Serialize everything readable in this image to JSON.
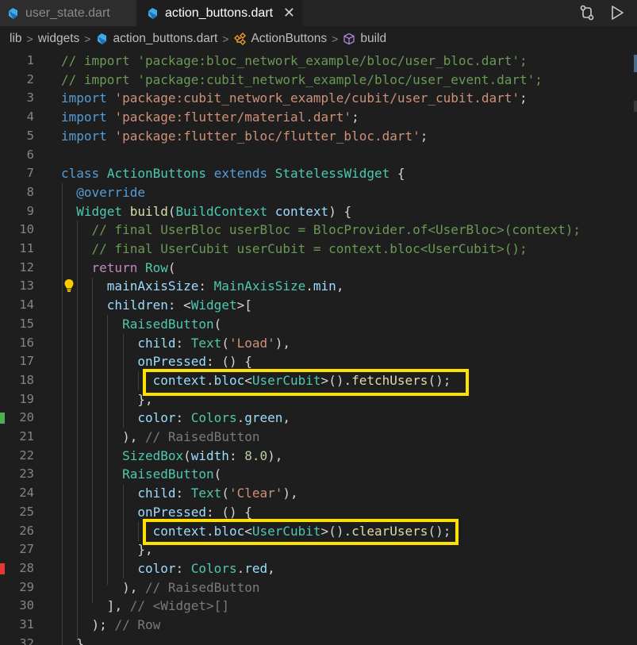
{
  "tabs": [
    {
      "label": "user_state.dart",
      "active": false,
      "icon": "dart-icon"
    },
    {
      "label": "action_buttons.dart",
      "active": true,
      "icon": "dart-icon",
      "close": "✕"
    }
  ],
  "toolbar_icons": [
    "source-control-compare-icon",
    "run-play-icon"
  ],
  "breadcrumbs": {
    "items": [
      "lib",
      "widgets",
      "action_buttons.dart",
      "ActionButtons",
      "build"
    ],
    "separator": ">"
  },
  "lines": [
    {
      "n": "1",
      "text": "// import 'package:bloc_network_example/bloc/user_bloc.dart';"
    },
    {
      "n": "2",
      "text": "// import 'package:cubit_network_example/bloc/user_event.dart';"
    },
    {
      "n": "3",
      "text": "import 'package:cubit_network_example/cubit/user_cubit.dart';"
    },
    {
      "n": "4",
      "text": "import 'package:flutter/material.dart';"
    },
    {
      "n": "5",
      "text": "import 'package:flutter_bloc/flutter_bloc.dart';"
    },
    {
      "n": "6",
      "text": ""
    },
    {
      "n": "7",
      "text": "class ActionButtons extends StatelessWidget {"
    },
    {
      "n": "8",
      "text": "  @override"
    },
    {
      "n": "9",
      "text": "  Widget build(BuildContext context) {"
    },
    {
      "n": "10",
      "text": "    // final UserBloc userBloc = BlocProvider.of<UserBloc>(context);"
    },
    {
      "n": "11",
      "text": "    // final UserCubit userCubit = context.bloc<UserCubit>();"
    },
    {
      "n": "12",
      "text": "    return Row("
    },
    {
      "n": "13",
      "text": "      mainAxisSize: MainAxisSize.min,"
    },
    {
      "n": "14",
      "text": "      children: <Widget>["
    },
    {
      "n": "15",
      "text": "        RaisedButton("
    },
    {
      "n": "16",
      "text": "          child: Text('Load'),"
    },
    {
      "n": "17",
      "text": "          onPressed: () {"
    },
    {
      "n": "18",
      "text": "            context.bloc<UserCubit>().fetchUsers();"
    },
    {
      "n": "19",
      "text": "          },"
    },
    {
      "n": "20",
      "text": "          color: Colors.green,"
    },
    {
      "n": "21",
      "text": "        ), // RaisedButton"
    },
    {
      "n": "22",
      "text": "        SizedBox(width: 8.0),"
    },
    {
      "n": "23",
      "text": "        RaisedButton("
    },
    {
      "n": "24",
      "text": "          child: Text('Clear'),"
    },
    {
      "n": "25",
      "text": "          onPressed: () {"
    },
    {
      "n": "26",
      "text": "            context.bloc<UserCubit>().clearUsers();"
    },
    {
      "n": "27",
      "text": "          },"
    },
    {
      "n": "28",
      "text": "          color: Colors.red,"
    },
    {
      "n": "29",
      "text": "        ), // RaisedButton"
    },
    {
      "n": "30",
      "text": "      ], // <Widget>[]"
    },
    {
      "n": "31",
      "text": "    ); // Row"
    },
    {
      "n": "32",
      "text": "  }"
    }
  ],
  "colors": {
    "highlight_box": "#ffe100",
    "gutter_green": "#4caf50",
    "gutter_red": "#e53935"
  }
}
